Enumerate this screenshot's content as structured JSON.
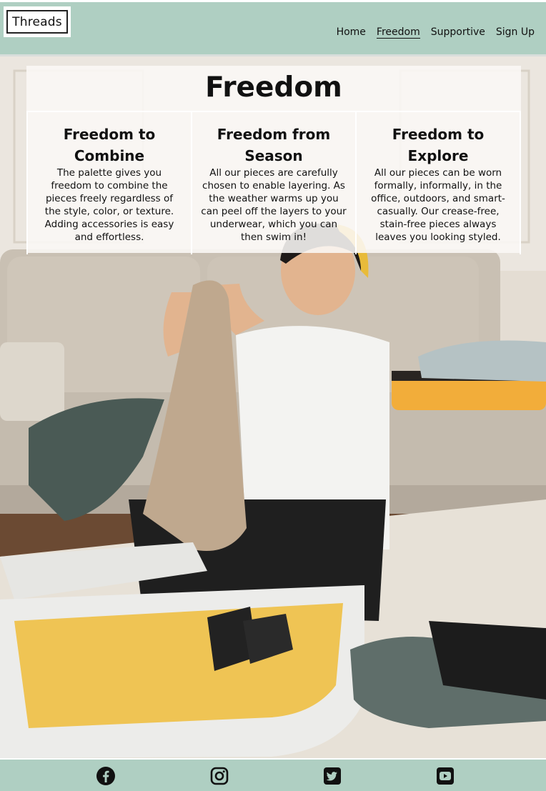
{
  "header": {
    "logo": "Threads",
    "nav": [
      {
        "label": "Home",
        "active": false
      },
      {
        "label": "Freedom",
        "active": true
      },
      {
        "label": "Supportive",
        "active": false
      },
      {
        "label": "Sign Up",
        "active": false
      }
    ]
  },
  "main": {
    "title": "Freedom",
    "columns": [
      {
        "heading": "Freedom to Combine",
        "text": "The palette gives you freedom to combine the pieces freely regardless of the style, color, or texture. Adding accessories is easy and effortless."
      },
      {
        "heading": "Freedom from Season",
        "text": "All our pieces are carefully chosen to enable layering. As the weather warms up you can peel off the layers to your underwear, which you can then swim in!"
      },
      {
        "heading": "Freedom to Explore",
        "text": "All our pieces can be worn formally, informally, in the office, outdoors, and smart-casually. Our crease-free, stain-free pieces always leaves you looking styled."
      }
    ],
    "background_image": "man-packing-suitcase-photo"
  },
  "footer": {
    "icons": [
      "facebook-icon",
      "instagram-icon",
      "twitter-icon",
      "youtube-icon"
    ]
  },
  "colors": {
    "accent": "#afcfc2",
    "text": "#111111"
  }
}
